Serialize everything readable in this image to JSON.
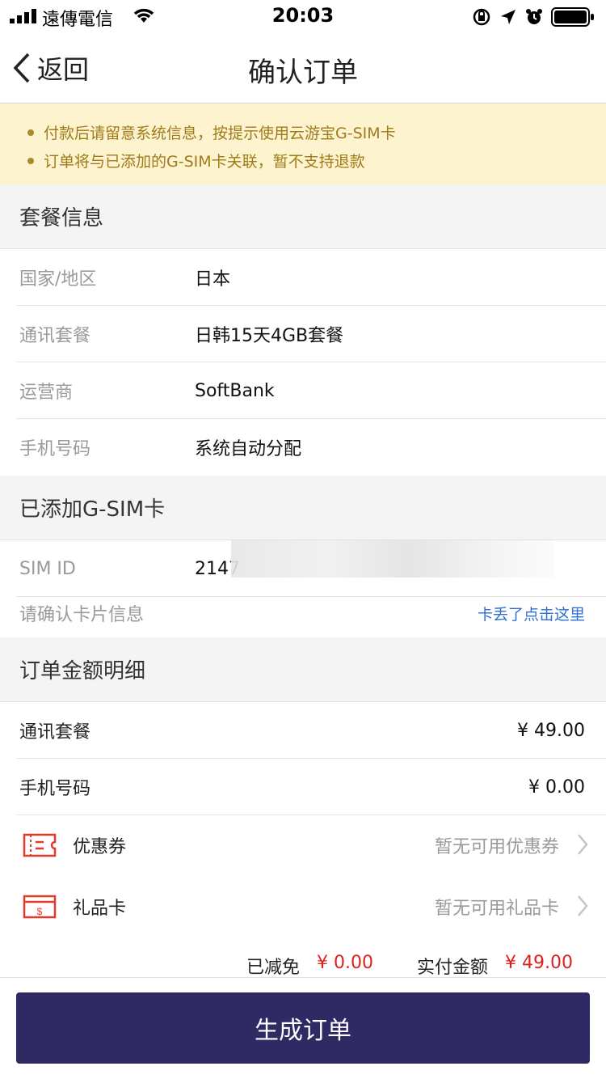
{
  "status_bar": {
    "carrier": "遠傳電信",
    "time": "20:03"
  },
  "nav": {
    "back_label": "返回",
    "title": "确认订单"
  },
  "notice": {
    "items": [
      "付款后请留意系统信息，按提示使用云游宝G-SIM卡",
      "订单将与已添加的G-SIM卡关联，暂不支持退款"
    ],
    "color": "#a07b1a",
    "background": "#fdf3cf"
  },
  "package_info": {
    "header": "套餐信息",
    "rows": [
      {
        "key": "国家/地区",
        "value": "日本"
      },
      {
        "key": "通讯套餐",
        "value": "日韩15天4GB套餐"
      },
      {
        "key": "运营商",
        "value": "SoftBank"
      },
      {
        "key": "手机号码",
        "value": "系统自动分配"
      }
    ]
  },
  "gsim": {
    "header": "已添加G-SIM卡",
    "sim_id_label": "SIM ID",
    "sim_id_value": "2147",
    "confirm_label": "请确认卡片信息",
    "lost_link": "卡丢了点击这里"
  },
  "order_detail": {
    "header": "订单金额明细",
    "rows": [
      {
        "key": "通讯套餐",
        "value": "¥  49.00"
      },
      {
        "key": "手机号码",
        "value": "¥  0.00"
      }
    ],
    "coupon": {
      "label": "优惠券",
      "hint": "暂无可用优惠券",
      "icon": "coupon-icon"
    },
    "gift_card": {
      "label": "礼品卡",
      "hint": "暂无可用礼品卡",
      "icon": "gift-card-icon"
    },
    "discount_label": "已减免",
    "discount_value": "¥ 0.00",
    "paid_label": "实付金额",
    "paid_value": "¥ 49.00"
  },
  "submit": {
    "label": "生成订单",
    "color": "#2f2a63"
  },
  "accent_red": "#e01f1f",
  "link_blue": "#2e6fd6"
}
